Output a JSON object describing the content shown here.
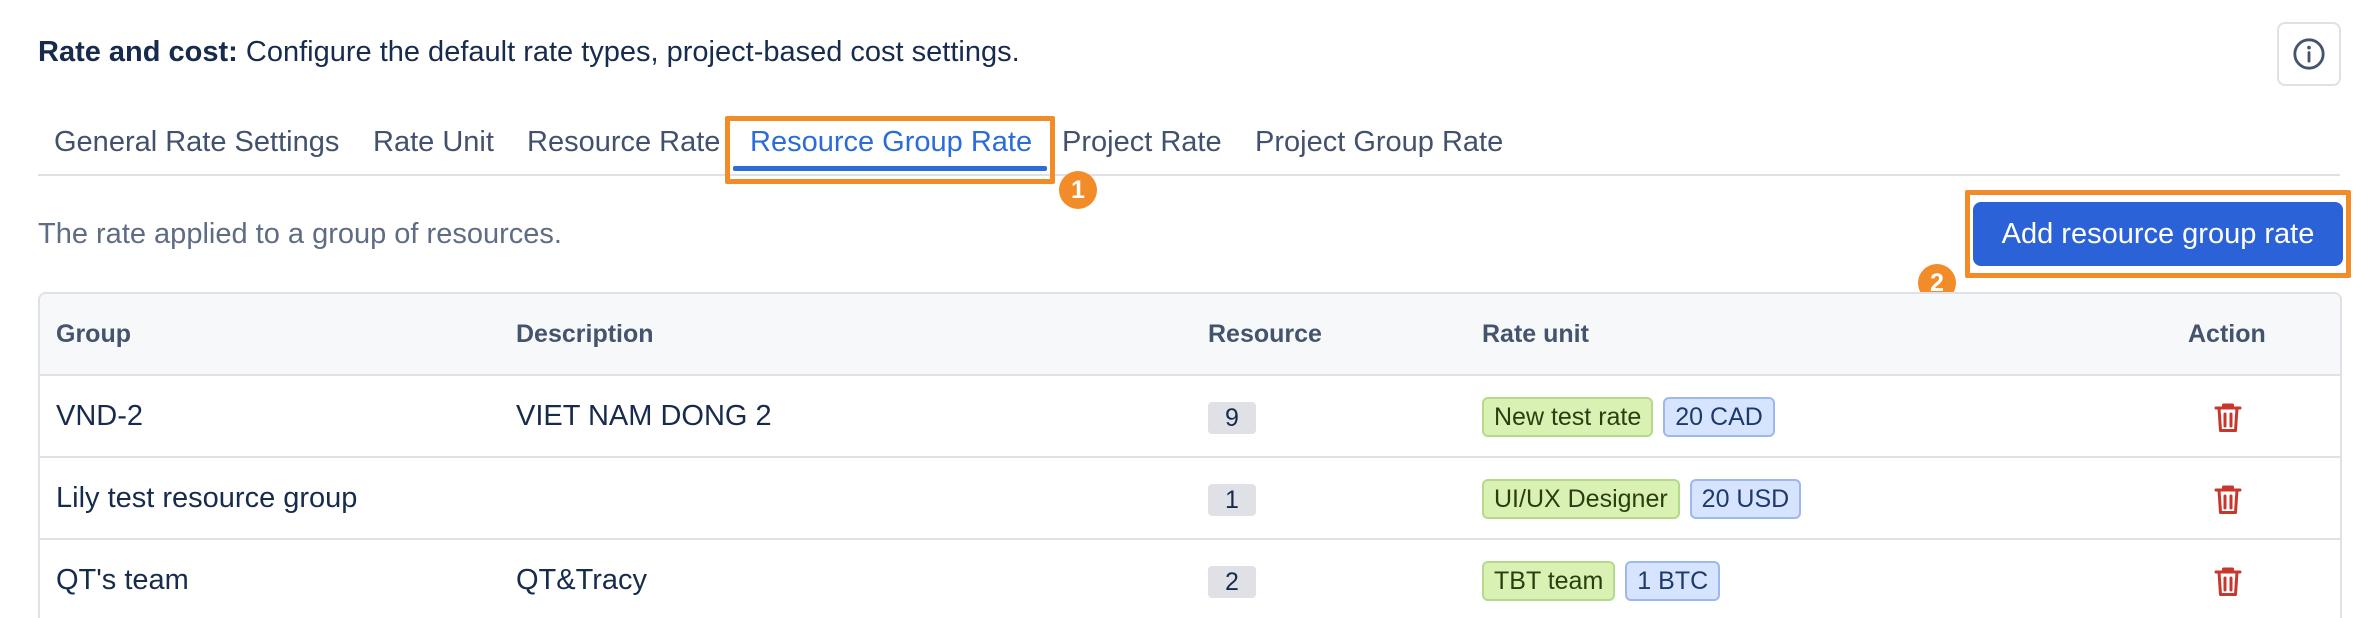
{
  "header": {
    "title_bold": "Rate and cost:",
    "title_text": "Configure the default rate types, project-based cost settings."
  },
  "tabs": [
    {
      "label": "General Rate Settings"
    },
    {
      "label": "Rate Unit"
    },
    {
      "label": "Resource Rate"
    },
    {
      "label": "Resource Group Rate",
      "active": true
    },
    {
      "label": "Project Rate"
    },
    {
      "label": "Project Group Rate"
    }
  ],
  "annotations": {
    "badge_1": "1",
    "badge_2": "2",
    "highlight_color": "#f28c28"
  },
  "subtitle": "The rate applied to a group of resources.",
  "add_button": {
    "label": "Add resource group rate"
  },
  "table": {
    "columns": {
      "group": "Group",
      "description": "Description",
      "resource": "Resource",
      "rate_unit": "Rate unit",
      "action": "Action"
    },
    "rows": [
      {
        "group": "VND-2",
        "description": "VIET NAM DONG 2",
        "resource": "9",
        "rate_name": "New test rate",
        "rate_value": "20 CAD"
      },
      {
        "group": "Lily test resource group",
        "description": "",
        "resource": "1",
        "rate_name": "UI/UX Designer",
        "rate_value": "20 USD"
      },
      {
        "group": "QT's team",
        "description": "QT&Tracy",
        "resource": "2",
        "rate_name": "TBT team",
        "rate_value": "1 BTC"
      }
    ]
  },
  "icons": {
    "info": "info-icon",
    "delete": "trash-icon"
  },
  "colors": {
    "accent": "#2b6cd8",
    "button": "#2b62d8",
    "delete": "#c9372c"
  }
}
